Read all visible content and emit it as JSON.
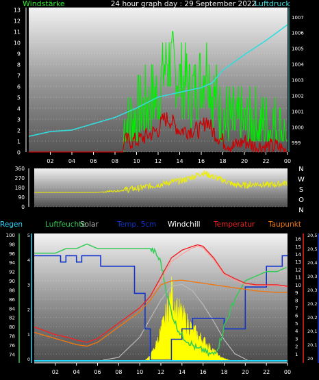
{
  "title": "24 hour graph day : 29 September 2022",
  "colors": {
    "background": "#000000",
    "wind_avg": "#00ee00",
    "wind_gust": "#cc0000",
    "pressure": "#33dddd",
    "wind_dir": "#eeee00",
    "humidity": "#33cc55",
    "solar": "#ffff00",
    "solar_max": "#bbbbbb",
    "temp_5cm": "#1133cc",
    "windchill": "#ffffff",
    "temperature": "#ee2222",
    "dewpoint": "#ee7711",
    "rain": "#22ddff",
    "tick_text": "#ffffff"
  },
  "chart_data": [
    {
      "type": "line",
      "x_unit": "hour",
      "x_ticks": [
        "02",
        "04",
        "06",
        "08",
        "10",
        "12",
        "14",
        "16",
        "18",
        "20",
        "22",
        "00"
      ],
      "left_axis": {
        "label": "Windstärke",
        "range": [
          0,
          13
        ],
        "ticks": [
          0,
          1,
          2,
          3,
          4,
          5,
          6,
          7,
          8,
          9,
          10,
          11,
          12,
          13
        ]
      },
      "right_axis": {
        "label": "Luftdruck",
        "range": [
          998.4,
          1007.6
        ],
        "ticks": [
          999,
          1000,
          1001,
          1002,
          1003,
          1004,
          1005,
          1006,
          1007
        ]
      },
      "series": [
        {
          "key": "wind_avg",
          "axis": "left",
          "x": [
            0,
            8.8,
            8.8,
            10,
            11,
            12,
            12.5,
            13,
            13.5,
            14,
            14.5,
            15,
            16,
            16.5,
            17,
            18,
            19,
            20,
            21,
            22,
            23,
            24
          ],
          "y": [
            0,
            0,
            2,
            3,
            4,
            5,
            7,
            8,
            7,
            6,
            6,
            5,
            6,
            8,
            5,
            3,
            2,
            2,
            2,
            2,
            2,
            1
          ]
        },
        {
          "key": "wind_gust",
          "axis": "left",
          "x": [
            0,
            8.8,
            8.8,
            10,
            11,
            12,
            12.5,
            13,
            13.5,
            14,
            14.5,
            15,
            16,
            16.5,
            17,
            18,
            19,
            20,
            21,
            22,
            23,
            24
          ],
          "y": [
            0,
            0,
            1,
            1,
            1.5,
            2,
            3,
            3,
            2.5,
            2,
            2,
            2,
            2,
            3,
            2,
            1,
            0.5,
            1,
            0.5,
            0.5,
            0.5,
            0
          ]
        },
        {
          "key": "pressure",
          "axis": "right",
          "x": [
            0,
            2,
            4,
            6,
            8,
            10,
            12,
            14,
            16,
            17,
            18,
            20,
            22,
            24
          ],
          "y": [
            999.4,
            999.7,
            999.8,
            1000.2,
            1000.6,
            1001.2,
            1001.9,
            1002.2,
            1002.5,
            1002.8,
            1003.6,
            1004.6,
            1005.5,
            1006.5
          ]
        }
      ]
    },
    {
      "type": "line",
      "x_unit": "hour",
      "left_axis": {
        "range": [
          0,
          360
        ],
        "ticks": [
          0,
          90,
          180,
          270,
          360
        ]
      },
      "right_labels": [
        "N",
        "W",
        "S",
        "O",
        "N"
      ],
      "series": [
        {
          "key": "wind_dir",
          "x": [
            0,
            6,
            7,
            8,
            9,
            10,
            11,
            12,
            13,
            14,
            15,
            16,
            17,
            18,
            19,
            20,
            21,
            22,
            23,
            24
          ],
          "y": [
            135,
            135,
            145,
            150,
            165,
            175,
            195,
            210,
            235,
            245,
            280,
            320,
            280,
            245,
            205,
            200,
            215,
            205,
            210,
            225
          ]
        }
      ]
    },
    {
      "type": "line",
      "x_unit": "hour",
      "x_ticks": [
        "02",
        "04",
        "06",
        "08",
        "10",
        "12",
        "14",
        "16",
        "18",
        "20",
        "22",
        "00"
      ],
      "legend": [
        "Regen",
        "Luftfeuchte",
        "Solar",
        "Temp. 5cm",
        "Windchill",
        "Temperatur",
        "Taupunkt"
      ],
      "left_axis_humidity": {
        "range": [
          73,
          100
        ],
        "ticks": [
          74,
          76,
          78,
          80,
          82,
          84,
          86,
          88,
          90,
          92,
          94,
          96,
          98,
          100
        ]
      },
      "left_axis_rain": {
        "range": [
          0,
          5
        ],
        "ticks": [
          0,
          1,
          2,
          3,
          4,
          5
        ]
      },
      "right_axis_temperature": {
        "range": [
          0,
          16.5
        ],
        "ticks": [
          1,
          2,
          3,
          4,
          5,
          6,
          7,
          8,
          9,
          10,
          11,
          12,
          13,
          14,
          15,
          16
        ]
      },
      "right_axis_temp5cm": {
        "range": [
          20,
          20.6
        ],
        "ticks": [
          "20",
          "20,1",
          "20,1",
          "20,2",
          "20,2",
          "20,3",
          "20,3",
          "20,4",
          "20,5",
          "20,5"
        ]
      },
      "series": [
        {
          "key": "solar_max",
          "unit": "0-1",
          "x": [
            6.5,
            8,
            10,
            11,
            12,
            13,
            14,
            15,
            16,
            17,
            18,
            19,
            20.2
          ],
          "y": [
            0,
            0.03,
            0.25,
            0.45,
            0.65,
            0.8,
            0.82,
            0.75,
            0.6,
            0.42,
            0.22,
            0.07,
            0
          ]
        },
        {
          "key": "solar",
          "unit": "0-1",
          "x": [
            10.5,
            11,
            11.5,
            12,
            12.5,
            13,
            13.3,
            13.6,
            14,
            14.5,
            15,
            15.5,
            16,
            16.5,
            17,
            17.5,
            18,
            18.5
          ],
          "y": [
            0,
            0.05,
            0.18,
            0.35,
            0.55,
            0.8,
            0.72,
            0.6,
            0.55,
            0.45,
            0.38,
            0.3,
            0.25,
            0.18,
            0.12,
            0.05,
            0.02,
            0
          ]
        },
        {
          "key": "humidity",
          "axis": "humidity",
          "x": [
            0,
            2,
            3,
            4,
            5,
            6,
            9,
            10.5,
            11,
            11.5,
            12,
            12.5,
            13,
            13.5,
            14,
            14.5,
            15,
            15.5,
            16,
            16.5,
            17,
            17.5,
            18,
            19,
            20,
            21,
            22,
            23,
            24
          ],
          "y": [
            96,
            96,
            97,
            97,
            98,
            97,
            97,
            97,
            97,
            96,
            94,
            88,
            83,
            80,
            78,
            77,
            76,
            75,
            75,
            74,
            74,
            76,
            80,
            86,
            90,
            91,
            92,
            92,
            93
          ]
        },
        {
          "key": "temperature",
          "axis": "temperature",
          "x": [
            0,
            1,
            2,
            3,
            4,
            5,
            6,
            7,
            8,
            9,
            10,
            11,
            12,
            13,
            14,
            15,
            15.5,
            16,
            17,
            18,
            19,
            20,
            21,
            22,
            23,
            24
          ],
          "y": [
            4.5,
            4,
            3.5,
            3.2,
            2.8,
            2.5,
            3,
            4,
            5,
            6,
            7,
            8.5,
            11,
            13.5,
            14.5,
            15,
            15.2,
            15,
            13.5,
            11.5,
            10.8,
            10.2,
            10,
            10,
            10,
            9.8
          ]
        },
        {
          "key": "dewpoint",
          "axis": "temperature",
          "x": [
            0,
            1,
            2,
            3,
            4,
            5,
            6,
            7,
            8,
            9,
            10,
            11,
            12,
            13,
            14,
            15,
            16,
            17,
            18,
            19,
            20,
            21,
            22,
            23,
            24
          ],
          "y": [
            3.8,
            3.4,
            3,
            2.6,
            2.2,
            2,
            2.5,
            3.5,
            4.5,
            5.5,
            6.5,
            8,
            10,
            10.5,
            10.6,
            10.4,
            10.2,
            10,
            9.8,
            9.6,
            9.4,
            9.2,
            9.1,
            9,
            9
          ]
        },
        {
          "key": "windchill",
          "axis": "temperature",
          "x": [
            0,
            1,
            2,
            3,
            4,
            5,
            6,
            7,
            8,
            9,
            10,
            11,
            12,
            13,
            14,
            15,
            15.5,
            16,
            17,
            18,
            19,
            20,
            21,
            22,
            23,
            24
          ],
          "y": [
            4.5,
            4,
            3.5,
            3.2,
            2.8,
            2.5,
            3,
            4,
            5,
            6,
            7,
            8.5,
            10.5,
            13,
            14,
            14.8,
            15,
            14.8,
            13.3,
            11.3,
            10.6,
            10,
            9.9,
            9.9,
            9.9,
            9.7
          ]
        },
        {
          "key": "temp_5cm",
          "axis": "temp5cm",
          "step": true,
          "x": [
            0,
            2.5,
            2.5,
            3.0,
            3.0,
            4.0,
            4.0,
            4.5,
            4.5,
            6.3,
            6.3,
            9.5,
            9.5,
            10.5,
            10.5,
            11.0,
            11.0,
            13.0,
            13.0,
            14.0,
            14.0,
            15.0,
            15.0,
            18.0,
            18.0,
            20.0,
            20.0,
            22.0,
            22.0,
            23.5,
            23.5,
            24
          ],
          "y": [
            20.5,
            20.5,
            20.47,
            20.47,
            20.5,
            20.5,
            20.47,
            20.47,
            20.5,
            20.5,
            20.45,
            20.45,
            20.32,
            20.32,
            20.15,
            20.15,
            20.0,
            20.0,
            20.1,
            20.1,
            20.15,
            20.15,
            20.2,
            20.2,
            20.15,
            20.15,
            20.35,
            20.35,
            20.45,
            20.45,
            20.5,
            20.5
          ]
        },
        {
          "key": "rain",
          "axis": "rain",
          "x": [
            0,
            24
          ],
          "y": [
            0,
            0
          ]
        }
      ]
    }
  ]
}
